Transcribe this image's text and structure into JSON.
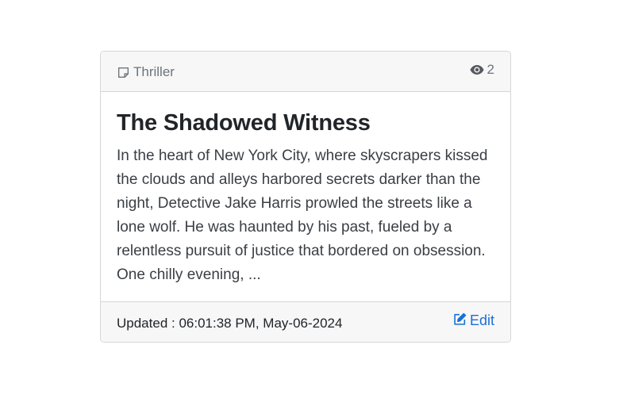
{
  "card": {
    "genre": "Thriller",
    "views": "2",
    "title": "The Shadowed Witness",
    "excerpt": "In the heart of New York City, where skyscrapers kissed the clouds and alleys harbored secrets darker than the night, Detective Jake Harris prowled the streets like a lone wolf. He was haunted by his past, fueled by a relentless pursuit of justice that bordered on obsession. One chilly evening, ...",
    "updated": "Updated : 06:01:38 PM, May-06-2024",
    "edit_label": "Edit"
  },
  "icons": {
    "genre": "sticky-note-icon",
    "views": "eye-icon",
    "edit": "pencil-square-icon"
  },
  "colors": {
    "link": "#1a6fd6",
    "muted": "#6c757d",
    "header_bg": "#f7f7f7"
  }
}
